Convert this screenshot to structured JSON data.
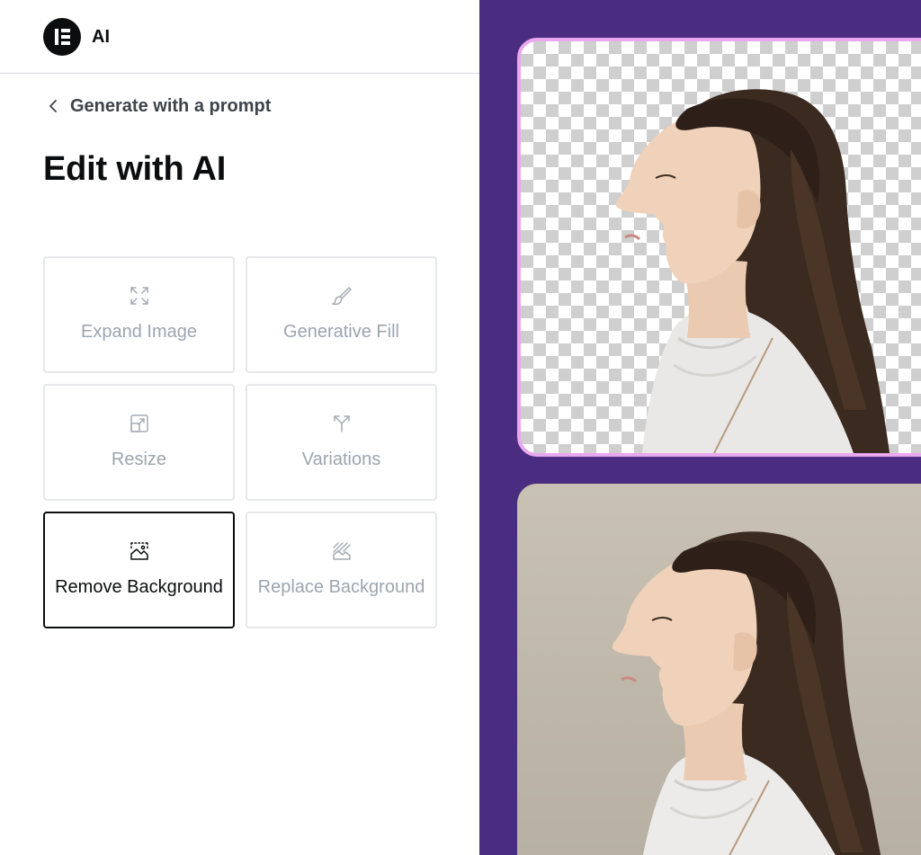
{
  "app": {
    "logo_icon": "elementor-logo-icon",
    "title": "AI"
  },
  "navigation": {
    "back_label": "Generate with a prompt",
    "back_icon": "chevron-left-icon"
  },
  "page": {
    "title": "Edit with AI"
  },
  "tools": [
    {
      "label": "Expand Image",
      "icon": "expand-arrows-icon",
      "active": false
    },
    {
      "label": "Generative Fill",
      "icon": "brush-icon",
      "active": false
    },
    {
      "label": "Resize",
      "icon": "resize-icon",
      "active": false
    },
    {
      "label": "Variations",
      "icon": "split-arrows-icon",
      "active": false
    },
    {
      "label": "Remove Background",
      "icon": "remove-background-icon",
      "active": true
    },
    {
      "label": "Replace Background",
      "icon": "replace-background-icon",
      "active": false
    }
  ],
  "preview": {
    "result_image": "woman-profile-transparent-background",
    "original_image": "woman-profile-beige-background"
  },
  "colors": {
    "preview_background": "#4a2d80",
    "result_frame_border": "#e9a8ee",
    "active_card_border": "#0c0d0e",
    "inactive_label": "#9da5ae"
  }
}
